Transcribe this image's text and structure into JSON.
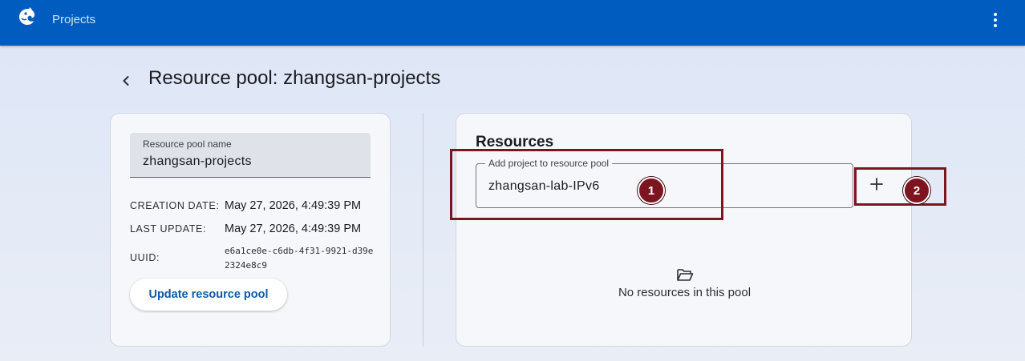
{
  "header": {
    "app_title": "Projects",
    "logo_icon": "chameleon-logo-icon",
    "menu_icon": "more-vertical-icon",
    "bar_color": "#005cbf"
  },
  "page": {
    "back_icon": "chevron-left-icon",
    "title": "Resource pool: zhangsan-projects"
  },
  "details": {
    "name_label": "Resource pool name",
    "name_value": "zhangsan-projects",
    "creation_label": "CREATION DATE:",
    "creation_value": "May 27, 2026, 4:49:39 PM",
    "update_label": "LAST UPDATE:",
    "update_value": "May 27, 2026, 4:49:39 PM",
    "uuid_label": "UUID:",
    "uuid_value": "e6a1ce0e-c6db-4f31-9921-d39e2324e8c9",
    "update_button": "Update resource pool"
  },
  "resources": {
    "title": "Resources",
    "add_label": "Add project to resource pool",
    "add_value": "zhangsan-lab-IPv6",
    "add_button_icon": "plus-icon",
    "empty_icon": "folder-open-icon",
    "empty_text": "No resources in this pool"
  },
  "annotations": {
    "marker_1": "1",
    "marker_2": "2",
    "color": "#7d1520"
  }
}
